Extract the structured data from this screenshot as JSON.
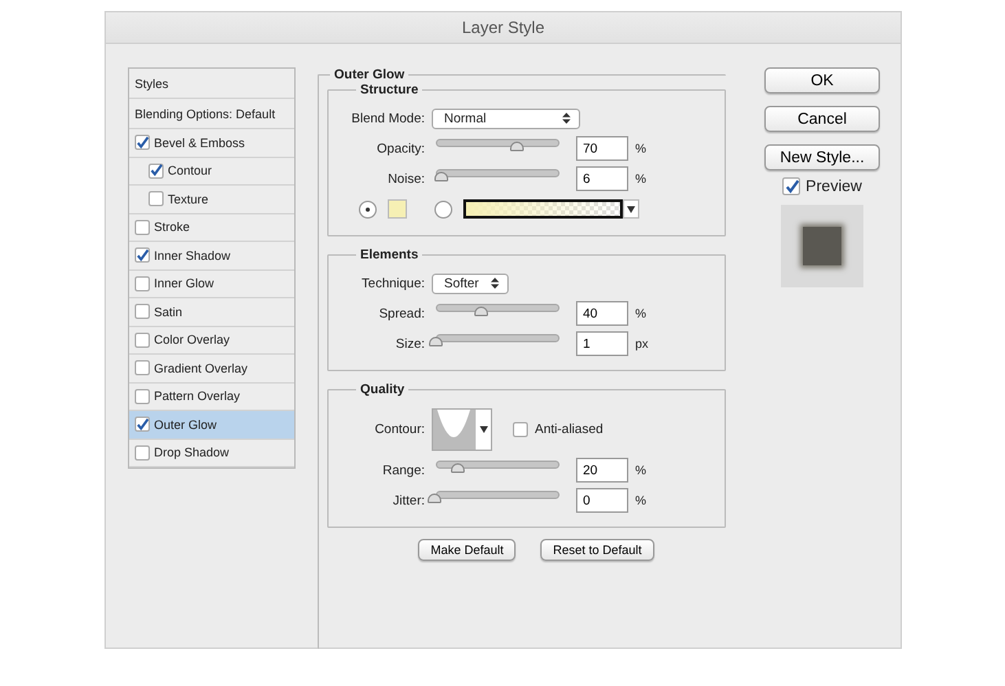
{
  "window": {
    "title": "Layer Style"
  },
  "styles_list": [
    {
      "label": "Styles",
      "kind": "header",
      "selected": false
    },
    {
      "label": "Blending Options: Default",
      "kind": "header",
      "selected": false
    },
    {
      "label": "Bevel & Emboss",
      "kind": "check",
      "checked": true,
      "selected": false,
      "sub": false
    },
    {
      "label": "Contour",
      "kind": "check",
      "checked": true,
      "selected": false,
      "sub": true
    },
    {
      "label": "Texture",
      "kind": "check",
      "checked": false,
      "selected": false,
      "sub": true
    },
    {
      "label": "Stroke",
      "kind": "check",
      "checked": false,
      "selected": false,
      "sub": false
    },
    {
      "label": "Inner Shadow",
      "kind": "check",
      "checked": true,
      "selected": false,
      "sub": false
    },
    {
      "label": "Inner Glow",
      "kind": "check",
      "checked": false,
      "selected": false,
      "sub": false
    },
    {
      "label": "Satin",
      "kind": "check",
      "checked": false,
      "selected": false,
      "sub": false
    },
    {
      "label": "Color Overlay",
      "kind": "check",
      "checked": false,
      "selected": false,
      "sub": false
    },
    {
      "label": "Gradient Overlay",
      "kind": "check",
      "checked": false,
      "selected": false,
      "sub": false
    },
    {
      "label": "Pattern Overlay",
      "kind": "check",
      "checked": false,
      "selected": false,
      "sub": false
    },
    {
      "label": "Outer Glow",
      "kind": "check",
      "checked": true,
      "selected": true,
      "sub": false
    },
    {
      "label": "Drop Shadow",
      "kind": "check",
      "checked": false,
      "selected": false,
      "sub": false
    }
  ],
  "panel": {
    "title": "Outer Glow",
    "structure": {
      "title": "Structure",
      "blend_mode": {
        "label": "Blend Mode:",
        "value": "Normal"
      },
      "sliders": [
        {
          "label": "Opacity:",
          "level": 0.7,
          "value": "70",
          "unit": "%"
        },
        {
          "label": "Noise:",
          "level": 0.06,
          "value": "6",
          "unit": "%"
        }
      ],
      "color_mode": [
        {
          "kind": "solid",
          "selected": true,
          "color": "#f6f0b4"
        },
        {
          "kind": "gradient",
          "selected": false,
          "color": "#f6f0b4"
        }
      ]
    },
    "elements": {
      "title": "Elements",
      "technique": {
        "label": "Technique:",
        "value": "Softer"
      },
      "sliders": [
        {
          "label": "Spread:",
          "level": 0.4,
          "value": "40",
          "unit": "%"
        },
        {
          "label": "Size:",
          "level": 0.01,
          "value": "1",
          "unit": "px"
        }
      ]
    },
    "quality": {
      "title": "Quality",
      "contour_label": "Contour:",
      "anti_aliased": {
        "label": "Anti-aliased",
        "checked": false
      },
      "sliders": [
        {
          "label": "Range:",
          "level": 0.2,
          "value": "20",
          "unit": "%"
        },
        {
          "label": "Jitter:",
          "level": 0,
          "value": "0",
          "unit": "%"
        }
      ]
    },
    "buttons": [
      "Make Default",
      "Reset to Default"
    ]
  },
  "buttons": [
    "OK",
    "Cancel",
    "New Style..."
  ],
  "preview": {
    "label": "Preview",
    "checked": true
  }
}
